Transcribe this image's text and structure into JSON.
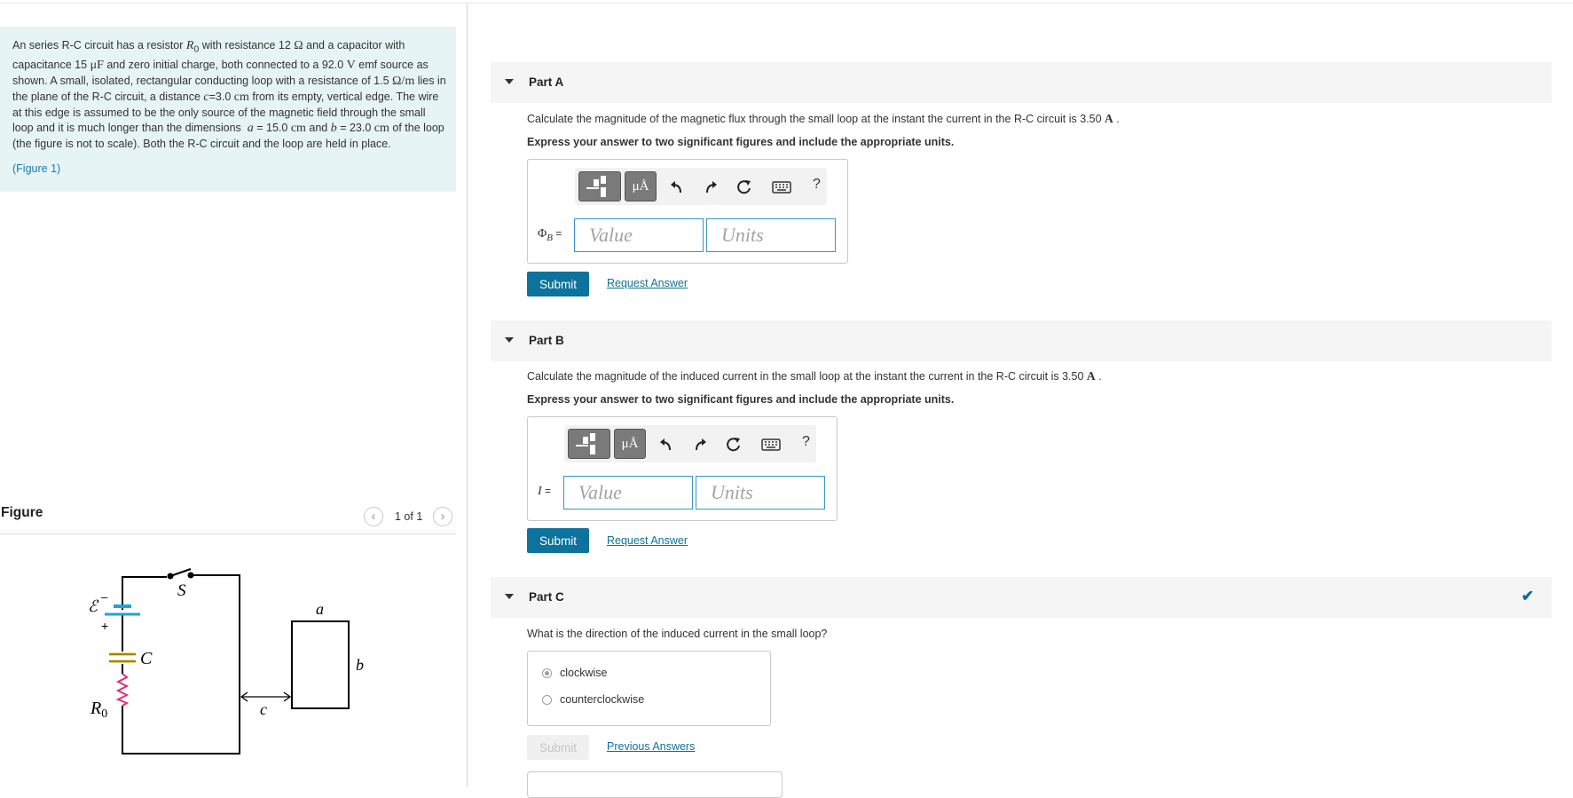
{
  "problem": {
    "text_html": "An series R-C circuit has a resistor <i>R</i><sub>0</sub> with resistance 12 <span class=\"m\">Ω</span> and a capacitor with capacitance 15 <span class=\"m\">μF</span> and zero initial charge, both connected to a 92.0 <span class=\"m\">V</span> emf source as shown. A small, isolated, rectangular conducting loop with a resistance of 1.5 <span class=\"m\">Ω/m</span> lies in the plane of the R-C circuit, a distance <i>c</i>=3.0 <span class=\"m\">cm</span> from its empty, vertical edge. The wire at this edge is assumed to be the only source of the magnetic field through the small loop and it is much longer than the dimensions &nbsp;<i>a</i> = 15.0 <span class=\"m\">cm</span> and <i>b</i> = 23.0 <span class=\"m\">cm</span> of the loop (the figure is not to scale). Both the R-C circuit and the loop are held in place.",
    "figure_link": "(Figure 1)"
  },
  "figure": {
    "title": "Figure",
    "pager": "1 of 1",
    "prev_icon": "chevron-left-icon",
    "next_icon": "chevron-right-icon",
    "labels": {
      "emf": "ℰ",
      "minus": "–",
      "plus": "+",
      "switch": "S",
      "capacitor": "C",
      "resistor": "R",
      "resistor_sub": "0",
      "a": "a",
      "b": "b",
      "c": "c"
    },
    "colors": {
      "battery": "#1ca3d8",
      "capacitor": "#d9b31a",
      "resistor": "#e0307a"
    }
  },
  "parts": {
    "a": {
      "title": "Part A",
      "question_pre": "Calculate the magnitude of the magnetic flux through the small loop at the instant the current in the R-C circuit is 3.50 ",
      "question_unit": "A",
      "question_post": " .",
      "instructions": "Express your answer to two significant figures and include the appropriate units.",
      "toolbar": {
        "units_button": "μÅ",
        "help": "?"
      },
      "var_symbol": "Φ",
      "var_sub": "B",
      "var_eq": " =",
      "value_placeholder": "Value",
      "units_placeholder": "Units",
      "submit": "Submit",
      "request": "Request Answer"
    },
    "b": {
      "title": "Part B",
      "question_pre": "Calculate the magnitude of the induced current in the small loop at the instant the current in the R-C circuit is 3.50 ",
      "question_unit": "A",
      "question_post": " .",
      "instructions": "Express your answer to two significant figures and include the appropriate units.",
      "toolbar": {
        "units_button": "μÅ",
        "help": "?"
      },
      "var_symbol": "I",
      "var_eq": " =",
      "value_placeholder": "Value",
      "units_placeholder": "Units",
      "submit": "Submit",
      "request": "Request Answer"
    },
    "c": {
      "title": "Part C",
      "complete_icon": "checkmark-icon",
      "question": "What is the direction of the induced current in the small loop?",
      "options": [
        "clockwise",
        "counterclockwise"
      ],
      "selected": "clockwise",
      "submit": "Submit",
      "previous": "Previous Answers"
    }
  }
}
